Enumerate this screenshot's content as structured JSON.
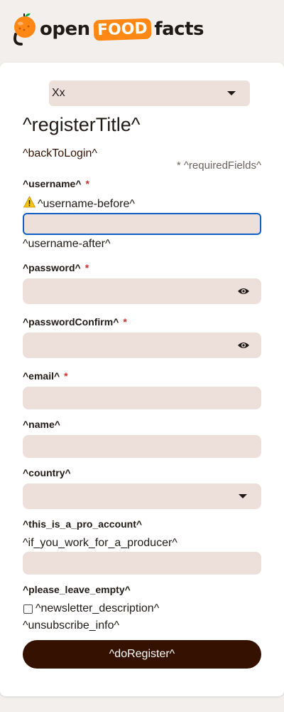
{
  "header": {
    "logo": {
      "open": "open",
      "food": "FOOD",
      "facts": "facts"
    }
  },
  "language": {
    "selected": "Xx"
  },
  "form": {
    "title": "^registerTitle^",
    "back_to_login": "^backToLogin^",
    "required_fields": "* ^requiredFields^",
    "required_star": "*",
    "username": {
      "label": "^username^",
      "before": "^username-before^",
      "after": "^username-after^",
      "value": ""
    },
    "password": {
      "label": "^password^",
      "value": ""
    },
    "password_confirm": {
      "label": "^passwordConfirm^",
      "value": ""
    },
    "email": {
      "label": "^email^",
      "value": ""
    },
    "name": {
      "label": "^name^",
      "value": ""
    },
    "country": {
      "label": "^country^",
      "value": ""
    },
    "pro_account": {
      "label": "^this_is_a_pro_account^",
      "helper": "^if_you_work_for_a_producer^",
      "value": ""
    },
    "leave_empty": {
      "label": "^please_leave_empty^"
    },
    "newsletter": {
      "label": "^newsletter_description^",
      "checked": false
    },
    "unsubscribe_info": "^unsubscribe_info^",
    "submit_label": "^doRegister^"
  },
  "colors": {
    "accent": "#ff8714",
    "button": "#341100",
    "field_bg": "#ede0db",
    "focus": "#0f5fc4",
    "required": "#c9302c"
  }
}
